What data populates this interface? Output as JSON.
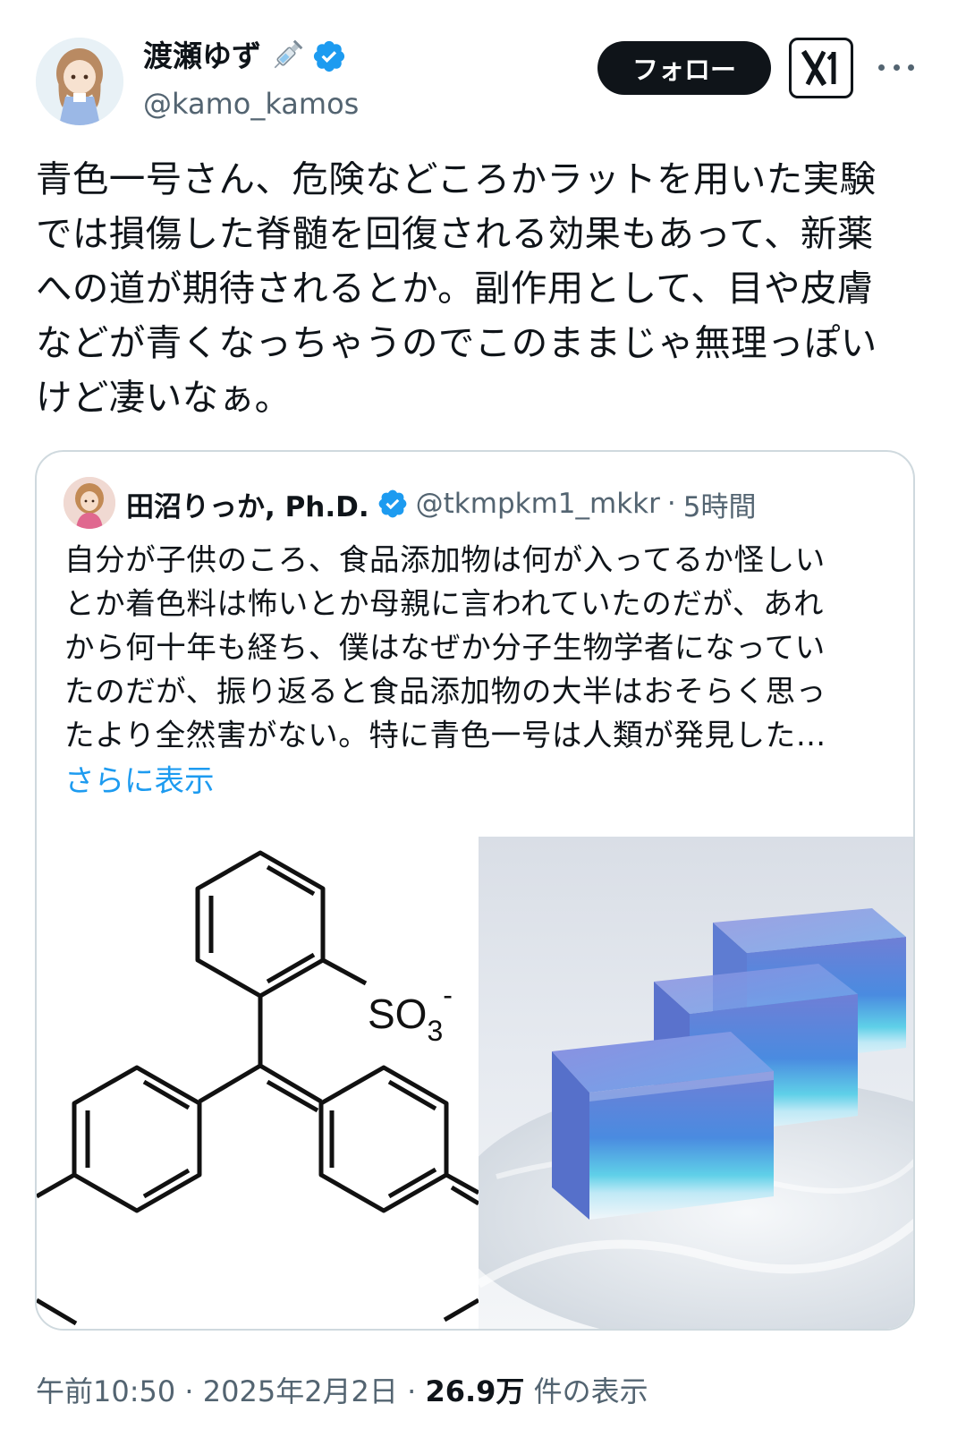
{
  "tweet": {
    "author_name": "渡瀬ゆず",
    "author_handle": "@kamo_kamos",
    "follow_label": "フォロー",
    "text": "青色一号さん、危険などころかラットを用いた実験\nでは損傷した脊髄を回復される効果もあって、新薬\nへの道が期待されるとか。副作用として、目や皮膚\nなどが青くなっちゃうのでこのままじゃ無理っぽい\nけど凄いなぁ。",
    "time": "午前10:50",
    "date": "2025年2月2日",
    "sep": "·",
    "views_count": "26.9万",
    "views_label": "件の表示"
  },
  "quote": {
    "author_name": "田沼りっか, Ph.D.",
    "author_handle": "@tkmpkm1_mkkr",
    "sep": "·",
    "time": "5時間",
    "text": "自分が子供のころ、食品添加物は何が入ってるか怪しい\nとか着色料は怖いとか母親に言われていたのだが、あれ\nから何十年も経ち、僕はなぜか分子生物学者になってい\nたのだが、振り返ると食品添加物の大半はおそらく思っ\nたより全然害がない。特に青色一号は人類が発見した…",
    "show_more": "さらに表示",
    "chem_label_so": "SO",
    "chem_label_sub": "3",
    "chem_label_charge": "-"
  },
  "colors": {
    "link": "#1d9bf0",
    "verified": "#1d9bf0",
    "secondary_text": "#536471",
    "border": "#cfd9de"
  },
  "icons": {
    "syringe": "syringe-emoji-icon",
    "verified": "verified-badge-icon",
    "xlogo": "grok-x-logo-icon",
    "more": "more-horizontal-icon"
  }
}
